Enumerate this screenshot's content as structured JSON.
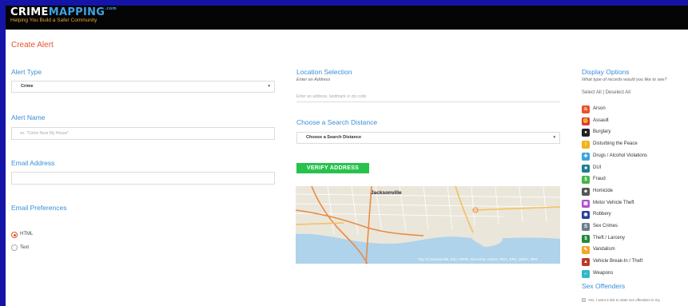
{
  "header": {
    "logo_crime": "CRIME",
    "logo_mapping": "MAPPING",
    "logo_com": ".com",
    "tagline": "Helping You Build a Safer Community"
  },
  "page_title": "Create Alert",
  "alert_type": {
    "label": "Alert Type",
    "value": "Crime"
  },
  "alert_name": {
    "label": "Alert Name",
    "placeholder": "ex. \"Crime Near My House\""
  },
  "email_address": {
    "label": "Email Address",
    "value": ""
  },
  "email_preferences": {
    "label": "Email Preferences",
    "options": [
      {
        "label": "HTML",
        "selected": true
      },
      {
        "label": "Text",
        "selected": false
      }
    ]
  },
  "location": {
    "label": "Location Selection",
    "sublabel": "Enter an Address",
    "placeholder": "Enter an address, landmark or zip code"
  },
  "search_distance": {
    "label": "Choose a Search Distance",
    "value": "Choose a Search Distance"
  },
  "verify_button": "VERIFY ADDRESS",
  "map": {
    "city_label": "Jacksonville",
    "attribution": "City of Jacksonville, Esri, HERE, DeLorme, USGS, NGA, EPA, USDA, NPS"
  },
  "display_options": {
    "label": "Display Options",
    "sublabel": "What type of records would you like to see?",
    "select_all": "Select All | Deselect All",
    "categories": [
      {
        "label": "Arson",
        "icon": "flame-icon",
        "color": "#e8512c",
        "glyph": "♨"
      },
      {
        "label": "Assault",
        "icon": "fist-icon",
        "color": "#d93a3a",
        "glyph": "✊"
      },
      {
        "label": "Burglary",
        "icon": "mask-icon",
        "color": "#222222",
        "glyph": "●"
      },
      {
        "label": "Disturbing the Peace",
        "icon": "exclamation-icon",
        "color": "#f2b21c",
        "glyph": "!"
      },
      {
        "label": "Drugs / Alcohol Violations",
        "icon": "pill-icon",
        "color": "#3aa5dc",
        "glyph": "✚"
      },
      {
        "label": "DUI",
        "icon": "car-icon",
        "color": "#1f7d8f",
        "glyph": "■"
      },
      {
        "label": "Fraud",
        "icon": "money-icon",
        "color": "#45b649",
        "glyph": "$"
      },
      {
        "label": "Homicide",
        "icon": "skull-icon",
        "color": "#555555",
        "glyph": "☻"
      },
      {
        "label": "Motor Vehicle Theft",
        "icon": "vehicle-icon",
        "color": "#b04fd1",
        "glyph": "▣"
      },
      {
        "label": "Robbery",
        "icon": "bag-icon",
        "color": "#2a3f9a",
        "glyph": "◉"
      },
      {
        "label": "Sex Crimes",
        "icon": "gender-icon",
        "color": "#6b7d8c",
        "glyph": "S"
      },
      {
        "label": "Theft / Larceny",
        "icon": "dollar-icon",
        "color": "#1e8a3a",
        "glyph": "$"
      },
      {
        "label": "Vandalism",
        "icon": "spray-icon",
        "color": "#f5a623",
        "glyph": "✎"
      },
      {
        "label": "Vehicle Break-In / Theft",
        "icon": "break-in-icon",
        "color": "#b83a2a",
        "glyph": "▲"
      },
      {
        "label": "Weapons",
        "icon": "gun-icon",
        "color": "#30b8c9",
        "glyph": "⌐"
      }
    ]
  },
  "sex_offenders": {
    "label": "Sex Offenders",
    "checkbox_text": "Yes, I want a link to state sex offenders in my"
  }
}
